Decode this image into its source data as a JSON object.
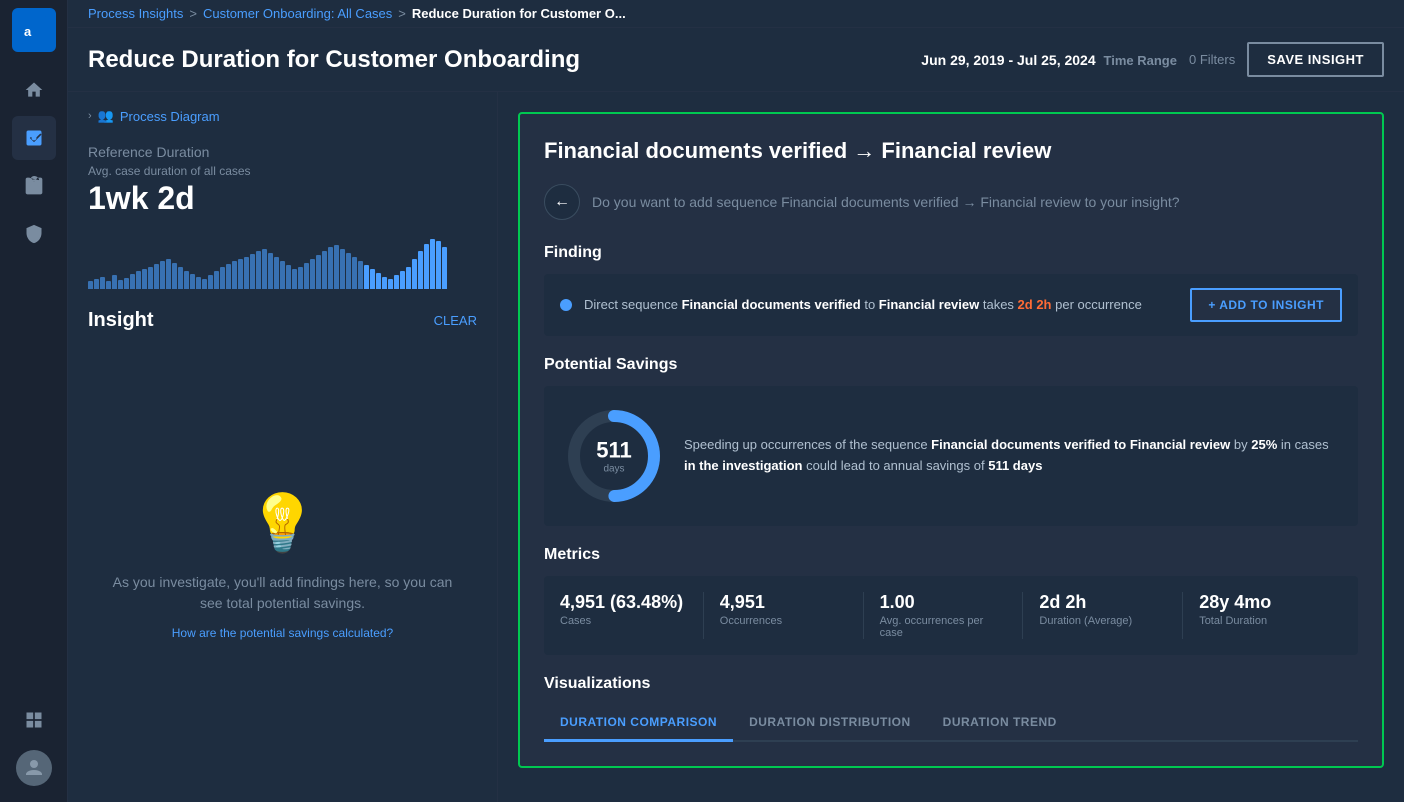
{
  "app": {
    "logo_text": "appian"
  },
  "breadcrumb": {
    "link1": "Process Insights",
    "sep1": ">",
    "link2": "Customer Onboarding: All Cases",
    "sep2": ">",
    "current": "Reduce Duration for Customer O..."
  },
  "header": {
    "title": "Reduce Duration for Customer Onboarding",
    "time_range_value": "Jun 29, 2019 - Jul 25, 2024",
    "time_range_label": "Time Range",
    "filters_label": "0 Filters",
    "save_btn": "SAVE INSIGHT"
  },
  "left_panel": {
    "process_diagram_label": "Process Diagram",
    "ref_duration_heading": "Reference Duration",
    "avg_duration_label": "Avg. case duration of all cases",
    "ref_duration_value": "1wk 2d",
    "insight_heading": "Insight",
    "clear_label": "CLEAR",
    "empty_text": "As you investigate, you'll add findings here, so you can see total potential savings.",
    "faq_text": "How are the potential savings calculated?"
  },
  "detail": {
    "title": "Financial documents verified → Financial review",
    "back_question": "Do you want to add sequence Financial documents verified → Financial review to your insight?",
    "finding_label": "Finding",
    "finding_text_prefix": "Direct sequence",
    "finding_bold1": "Financial documents verified",
    "finding_to": "to",
    "finding_bold2": "Financial review",
    "finding_takes": "takes",
    "finding_highlight": "2d 2h",
    "finding_suffix": "per occurrence",
    "add_btn": "+ ADD TO INSIGHT",
    "savings_label": "Potential Savings",
    "donut_value": "511",
    "donut_unit": "days",
    "savings_text_prefix": "Speeding up occurrences of the sequence",
    "savings_bold1": "Financial documents verified to Financial review",
    "savings_by": "by",
    "savings_pct": "25%",
    "savings_in": "in cases",
    "savings_in_bold": "in the investigation",
    "savings_could": "could lead to annual savings of",
    "savings_days_bold": "511 days",
    "metrics_label": "Metrics",
    "metrics": [
      {
        "value": "4,951 (63.48%)",
        "label": "Cases"
      },
      {
        "value": "4,951",
        "label": "Occurrences"
      },
      {
        "value": "1.00",
        "label": "Avg. occurrences per case"
      },
      {
        "value": "2d 2h",
        "label": "Duration (Average)"
      },
      {
        "value": "28y 4mo",
        "label": "Total Duration"
      }
    ],
    "viz_label": "Visualizations",
    "viz_tabs": [
      {
        "label": "DURATION COMPARISON",
        "active": true
      },
      {
        "label": "DURATION DISTRIBUTION",
        "active": false
      },
      {
        "label": "DURATION TREND",
        "active": false
      }
    ]
  },
  "sidebar": {
    "items": [
      {
        "icon": "🏠",
        "name": "home"
      },
      {
        "icon": "📊",
        "name": "analytics",
        "active": true
      },
      {
        "icon": "🗄️",
        "name": "data"
      },
      {
        "icon": "🛡️",
        "name": "security"
      }
    ]
  },
  "colors": {
    "accent": "#4a9eff",
    "highlight": "#ff6b35",
    "border_active": "#00c851"
  }
}
